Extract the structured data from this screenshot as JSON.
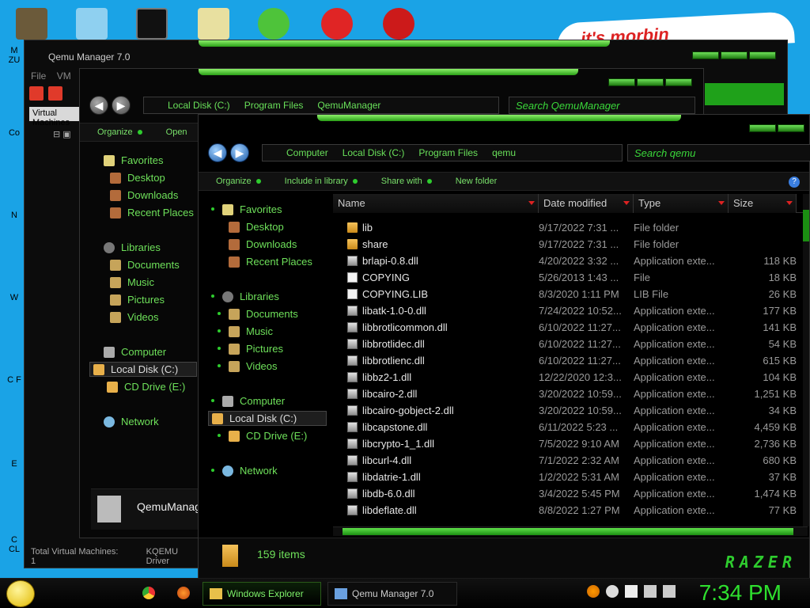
{
  "desktop": {
    "left_icon_labels": [
      "M ZU",
      "Co",
      "N",
      "W",
      "C F",
      "E",
      "C CL"
    ],
    "poster_text": "it's morbin"
  },
  "qemu_window": {
    "title": "Qemu Manager 7.0",
    "menu": [
      "File",
      "VM"
    ],
    "vm_list_header": "Virtual Machines",
    "vm_item": "QemuManager",
    "status_total": "Total Virtual Machines: 1",
    "status_driver": "KQEMU Driver"
  },
  "explorer_back": {
    "address": [
      "Local Disk (C:)",
      "Program Files",
      "QemuManager"
    ],
    "search_placeholder": "Search QemuManager",
    "commands": [
      "Organize",
      "Open"
    ],
    "nav": {
      "favorites": "Favorites",
      "fav_items": [
        "Desktop",
        "Downloads",
        "Recent Places"
      ],
      "libraries": "Libraries",
      "lib_items": [
        "Documents",
        "Music",
        "Pictures",
        "Videos"
      ],
      "computer": "Computer",
      "drives": [
        "Local Disk (C:)",
        "CD Drive (E:)"
      ],
      "network": "Network"
    },
    "details_title": "QemuManager"
  },
  "explorer_front": {
    "address": [
      "Computer",
      "Local Disk (C:)",
      "Program Files",
      "qemu"
    ],
    "search_placeholder": "Search qemu",
    "commands": [
      "Organize",
      "Include in library",
      "Share with",
      "New folder"
    ],
    "nav": {
      "favorites": "Favorites",
      "fav_items": [
        "Desktop",
        "Downloads",
        "Recent Places"
      ],
      "libraries": "Libraries",
      "lib_items": [
        "Documents",
        "Music",
        "Pictures",
        "Videos"
      ],
      "computer": "Computer",
      "drives": [
        "Local Disk (C:)",
        "CD Drive (E:)"
      ],
      "network": "Network"
    },
    "columns": [
      "Name",
      "Date modified",
      "Type",
      "Size"
    ],
    "files": [
      {
        "name": "lib",
        "date": "9/17/2022 7:31 ...",
        "type": "File folder",
        "size": "",
        "icon": "folder"
      },
      {
        "name": "share",
        "date": "9/17/2022 7:31 ...",
        "type": "File folder",
        "size": "",
        "icon": "folder"
      },
      {
        "name": "brlapi-0.8.dll",
        "date": "4/20/2022 3:32 ...",
        "type": "Application exte...",
        "size": "118 KB",
        "icon": "dll"
      },
      {
        "name": "COPYING",
        "date": "5/26/2013 1:43 ...",
        "type": "File",
        "size": "18 KB",
        "icon": "file"
      },
      {
        "name": "COPYING.LIB",
        "date": "8/3/2020 1:11 PM",
        "type": "LIB File",
        "size": "26 KB",
        "icon": "file"
      },
      {
        "name": "libatk-1.0-0.dll",
        "date": "7/24/2022 10:52...",
        "type": "Application exte...",
        "size": "177 KB",
        "icon": "dll"
      },
      {
        "name": "libbrotlicommon.dll",
        "date": "6/10/2022 11:27...",
        "type": "Application exte...",
        "size": "141 KB",
        "icon": "dll"
      },
      {
        "name": "libbrotlidec.dll",
        "date": "6/10/2022 11:27...",
        "type": "Application exte...",
        "size": "54 KB",
        "icon": "dll"
      },
      {
        "name": "libbrotlienc.dll",
        "date": "6/10/2022 11:27...",
        "type": "Application exte...",
        "size": "615 KB",
        "icon": "dll"
      },
      {
        "name": "libbz2-1.dll",
        "date": "12/22/2020 12:3...",
        "type": "Application exte...",
        "size": "104 KB",
        "icon": "dll"
      },
      {
        "name": "libcairo-2.dll",
        "date": "3/20/2022 10:59...",
        "type": "Application exte...",
        "size": "1,251 KB",
        "icon": "dll"
      },
      {
        "name": "libcairo-gobject-2.dll",
        "date": "3/20/2022 10:59...",
        "type": "Application exte...",
        "size": "34 KB",
        "icon": "dll"
      },
      {
        "name": "libcapstone.dll",
        "date": "6/11/2022 5:23 ...",
        "type": "Application exte...",
        "size": "4,459 KB",
        "icon": "dll"
      },
      {
        "name": "libcrypto-1_1.dll",
        "date": "7/5/2022 9:10 AM",
        "type": "Application exte...",
        "size": "2,736 KB",
        "icon": "dll"
      },
      {
        "name": "libcurl-4.dll",
        "date": "7/1/2022 2:32 AM",
        "type": "Application exte...",
        "size": "680 KB",
        "icon": "dll"
      },
      {
        "name": "libdatrie-1.dll",
        "date": "1/2/2022 5:31 AM",
        "type": "Application exte...",
        "size": "37 KB",
        "icon": "dll"
      },
      {
        "name": "libdb-6.0.dll",
        "date": "3/4/2022 5:45 PM",
        "type": "Application exte...",
        "size": "1,474 KB",
        "icon": "dll"
      },
      {
        "name": "libdeflate.dll",
        "date": "8/8/2022 1:27 PM",
        "type": "Application exte...",
        "size": "77 KB",
        "icon": "dll"
      }
    ],
    "item_count": "159 items",
    "brand": "RAZER"
  },
  "taskbar": {
    "tasks": [
      {
        "label": "Windows Explorer",
        "active": true
      },
      {
        "label": "Qemu Manager 7.0",
        "active": false
      }
    ],
    "clock": "7:34 PM"
  },
  "colors": {
    "accent_green": "#2ecc2e",
    "text_green": "#6ee05a",
    "desktop_blue": "#1aa3e6"
  }
}
